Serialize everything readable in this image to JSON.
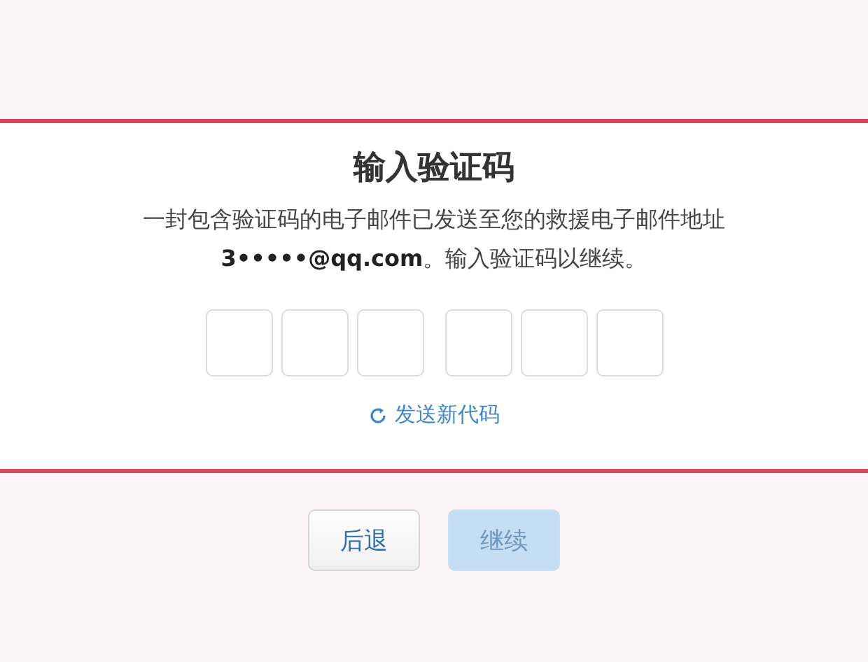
{
  "title": "输入验证码",
  "message_lines": [
    "一封包含验证码的电子邮件已发送至您的救援电子邮件地址",
    "**3•••••@qq.com**。输入验证码以继续。"
  ],
  "code_fields": [
    {
      "kind": "digit"
    },
    {
      "kind": "digit"
    },
    {
      "kind": "digit"
    },
    {
      "kind": "gap"
    },
    {
      "kind": "digit"
    },
    {
      "kind": "digit"
    },
    {
      "kind": "digit"
    }
  ],
  "resend_link": "发送新代码",
  "buttons": [
    {
      "label": "后退",
      "disabled": false
    },
    {
      "label": "继续",
      "disabled": true
    }
  ]
}
